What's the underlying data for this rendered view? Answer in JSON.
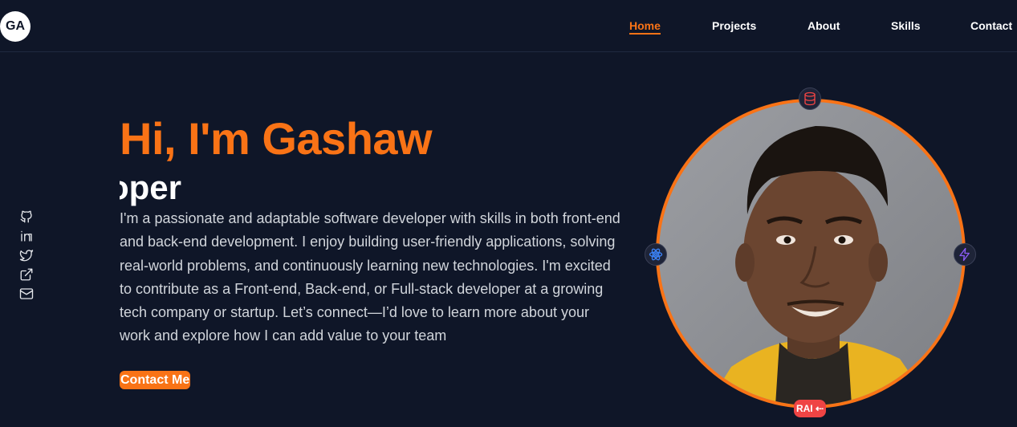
{
  "header": {
    "logo_text": "GA",
    "nav": [
      {
        "label": "Home",
        "active": true
      },
      {
        "label": "Projects",
        "active": false
      },
      {
        "label": "About",
        "active": false
      },
      {
        "label": "Skills",
        "active": false
      },
      {
        "label": "Contact",
        "active": false
      }
    ]
  },
  "social_links": [
    {
      "icon": "github-icon"
    },
    {
      "icon": "linkedin-icon"
    },
    {
      "icon": "twitter-icon"
    },
    {
      "icon": "external-link-icon"
    },
    {
      "icon": "mail-icon"
    }
  ],
  "hero": {
    "greeting": "Hi, I'm Gashaw",
    "role_typed": "oper",
    "bio": "I'm a passionate and adaptable software developer with skills in both front-end and back-end development. I enjoy building user-friendly applications, solving real-world problems, and continuously learning new technologies. I'm excited to contribute as a Front-end, Back-end, or Full-stack developer at a growing tech company or startup. Let’s connect—I’d love to learn more about your work and explore how I can add value to your team",
    "cta_label": "Contact Me"
  },
  "avatar": {
    "orbit_icons": [
      "database-icon",
      "react-icon",
      "lightning-icon"
    ],
    "badge_text": "RAI ⇠"
  },
  "colors": {
    "background": "#0f1628",
    "accent": "#f97316",
    "badge": "#ef4444"
  }
}
